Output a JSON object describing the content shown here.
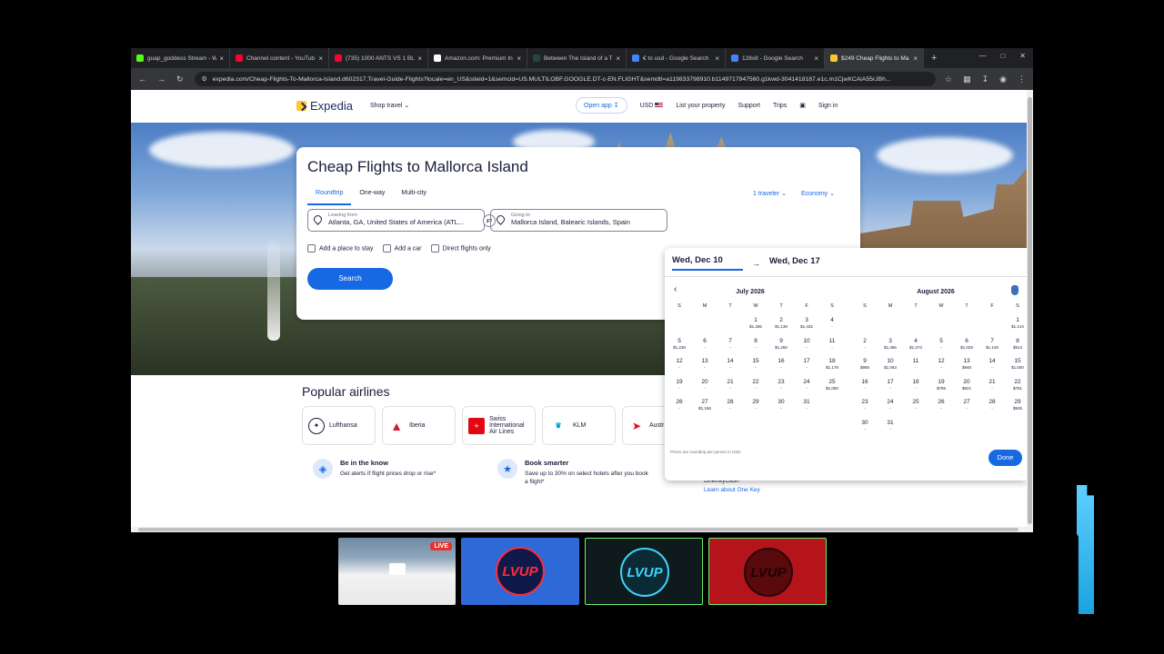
{
  "browser": {
    "tabs": [
      {
        "title": "guap_goddess Stream - W",
        "color": "#53fc18",
        "active": false
      },
      {
        "title": "Channel content - YouTub",
        "color": "#ff0033",
        "active": false
      },
      {
        "title": "(735) 1000 ANTS VS 1 BLA",
        "color": "#ff0033",
        "active": false
      },
      {
        "title": "Amazon.com: Premium In",
        "color": "#ffffff",
        "active": false
      },
      {
        "title": "Between The Island of a Th",
        "color": "#1f4a3a",
        "active": false
      },
      {
        "title": "€ to usd - Google Search",
        "color": "#4285f4",
        "active": false
      },
      {
        "title": "128x8 - Google Search",
        "color": "#4285f4",
        "active": false
      },
      {
        "title": "$249 Cheap Flights to Ma",
        "color": "#ffc72c",
        "active": true
      }
    ],
    "new_tab": "+",
    "url": "expedia.com/Cheap-Flights-To-Mallorca-Island.d602317.Travel-Guide-Flights?locale=en_US&siteid=1&semcid=US.MULTILOBF.GOOGLE.DT-c-EN.FLIGHT&semdtl=a119833798910.b1149717947560.g1kwd-3041418187.e1c.m1CjwKCAiA55rJBh..."
  },
  "header": {
    "logo": "Expedia",
    "shop_travel": "Shop travel",
    "open_app": "Open app",
    "currency": "USD",
    "list_property": "List your property",
    "support": "Support",
    "trips": "Trips",
    "sign_in": "Sign in"
  },
  "search": {
    "title": "Cheap Flights to Mallorca Island",
    "tabs": [
      "Roundtrip",
      "One-way",
      "Multi-city"
    ],
    "travelers": "1 traveler",
    "cabin": "Economy",
    "leaving_label": "Leaving from",
    "leaving_value": "Atlanta, GA, United States of America (ATL...",
    "going_label": "Going to",
    "going_value": "Mallorca Island, Balearic Islands, Spain",
    "checks": [
      "Add a place to stay",
      "Add a car",
      "Direct flights only"
    ],
    "search_button": "Search"
  },
  "popular": {
    "title": "Popular airlines",
    "airlines": [
      {
        "name": "Lufthansa"
      },
      {
        "name": "Iberia"
      },
      {
        "name": "Swiss International Air Lines"
      },
      {
        "name": "KLM"
      },
      {
        "name": "Austr Airlin"
      }
    ]
  },
  "info": [
    {
      "heading": "Be in the know",
      "desc": "Get alerts if flight prices drop or rise*",
      "link": ""
    },
    {
      "heading": "Book smarter",
      "desc": "Save up to 30% on select hotels after you book a flight*",
      "link": ""
    },
    {
      "heading": "",
      "desc": "Earn your airline miles on top of our OneKeyCash",
      "link": "Learn about One Key"
    }
  ],
  "calendar": {
    "depart": "Wed, Dec 10",
    "return": "Wed, Dec 17",
    "dow": [
      "S",
      "M",
      "T",
      "W",
      "T",
      "F",
      "S"
    ],
    "months": [
      {
        "title": "July 2026",
        "offset": 3,
        "days": [
          {
            "n": "1",
            "p": "$1,286"
          },
          {
            "n": "2",
            "p": "$1,139"
          },
          {
            "n": "3",
            "p": "$1,432"
          },
          {
            "n": "4",
            "p": "-"
          },
          {
            "n": "5",
            "p": "$1,239"
          },
          {
            "n": "6",
            "p": "-"
          },
          {
            "n": "7",
            "p": "-"
          },
          {
            "n": "8",
            "p": "-"
          },
          {
            "n": "9",
            "p": "$1,250"
          },
          {
            "n": "10",
            "p": "-"
          },
          {
            "n": "11",
            "p": "-"
          },
          {
            "n": "12",
            "p": "-"
          },
          {
            "n": "13",
            "p": "-"
          },
          {
            "n": "14",
            "p": "-"
          },
          {
            "n": "15",
            "p": "-"
          },
          {
            "n": "16",
            "p": "-"
          },
          {
            "n": "17",
            "p": "-"
          },
          {
            "n": "18",
            "p": "$1,178"
          },
          {
            "n": "19",
            "p": "-"
          },
          {
            "n": "20",
            "p": "-"
          },
          {
            "n": "21",
            "p": "-"
          },
          {
            "n": "22",
            "p": "-"
          },
          {
            "n": "23",
            "p": "-"
          },
          {
            "n": "24",
            "p": "-"
          },
          {
            "n": "25",
            "p": "$1,060"
          },
          {
            "n": "26",
            "p": "-"
          },
          {
            "n": "27",
            "p": "$1,166"
          },
          {
            "n": "28",
            "p": "-"
          },
          {
            "n": "29",
            "p": "-"
          },
          {
            "n": "30",
            "p": "-"
          },
          {
            "n": "31",
            "p": "-"
          }
        ]
      },
      {
        "title": "August 2026",
        "offset": 6,
        "days": [
          {
            "n": "1",
            "p": "$1,144"
          },
          {
            "n": "2",
            "p": "-"
          },
          {
            "n": "3",
            "p": "$1,366"
          },
          {
            "n": "4",
            "p": "$1,274"
          },
          {
            "n": "5",
            "p": "-"
          },
          {
            "n": "6",
            "p": "$1,029"
          },
          {
            "n": "7",
            "p": "$1,149"
          },
          {
            "n": "8",
            "p": "$913"
          },
          {
            "n": "9",
            "p": "$988"
          },
          {
            "n": "10",
            "p": "$1,063"
          },
          {
            "n": "11",
            "p": "-"
          },
          {
            "n": "12",
            "p": "-"
          },
          {
            "n": "13",
            "p": "$948"
          },
          {
            "n": "14",
            "p": "-"
          },
          {
            "n": "15",
            "p": "$1,000"
          },
          {
            "n": "16",
            "p": "-"
          },
          {
            "n": "17",
            "p": "-"
          },
          {
            "n": "18",
            "p": "-"
          },
          {
            "n": "19",
            "p": "$796"
          },
          {
            "n": "20",
            "p": "$921"
          },
          {
            "n": "21",
            "p": "-"
          },
          {
            "n": "22",
            "p": "$781"
          },
          {
            "n": "23",
            "p": "-"
          },
          {
            "n": "24",
            "p": "-"
          },
          {
            "n": "25",
            "p": "-"
          },
          {
            "n": "26",
            "p": "-"
          },
          {
            "n": "27",
            "p": "-"
          },
          {
            "n": "28",
            "p": "-"
          },
          {
            "n": "29",
            "p": "$845"
          },
          {
            "n": "30",
            "p": "-"
          },
          {
            "n": "31",
            "p": "-"
          }
        ]
      }
    ],
    "footnote": "Prices are roundtrip per person in USD",
    "done": "Done"
  },
  "stream": {
    "live": "LIVE",
    "badges": [
      "LVUP",
      "LVUP",
      "LVUP"
    ]
  }
}
